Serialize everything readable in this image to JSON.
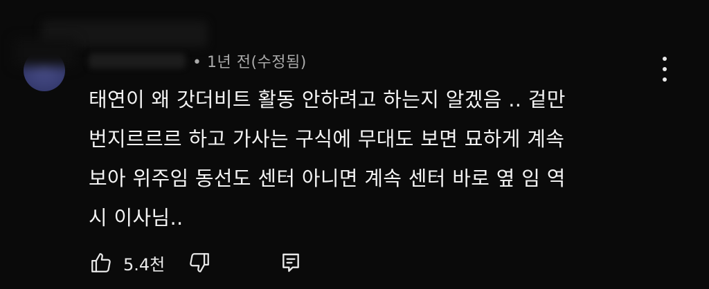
{
  "comment": {
    "author": "",
    "meta": "• 1년 전(수정됨)",
    "text_lines": [
      "태연이 왜 갓더비트 활동 안하려고 하는지 알겠음 .. 겉만",
      "번지르르르 하고 가사는 구식에 무대도 보면 묘하게 계속",
      "보아 위주임 동선도 센터 아니면 계속 센터 바로 옆 임 역",
      "시 이사님.."
    ],
    "like_count": "5.4천"
  },
  "icons": {
    "like": "thumbs-up-icon",
    "dislike": "thumbs-down-icon",
    "reply": "reply-comment-icon",
    "more": "more-vertical-icon"
  },
  "colors": {
    "background": "#0a0a0a",
    "text": "#f1f1f1",
    "meta": "#aaaaaa",
    "avatar": "#3a3f75"
  }
}
